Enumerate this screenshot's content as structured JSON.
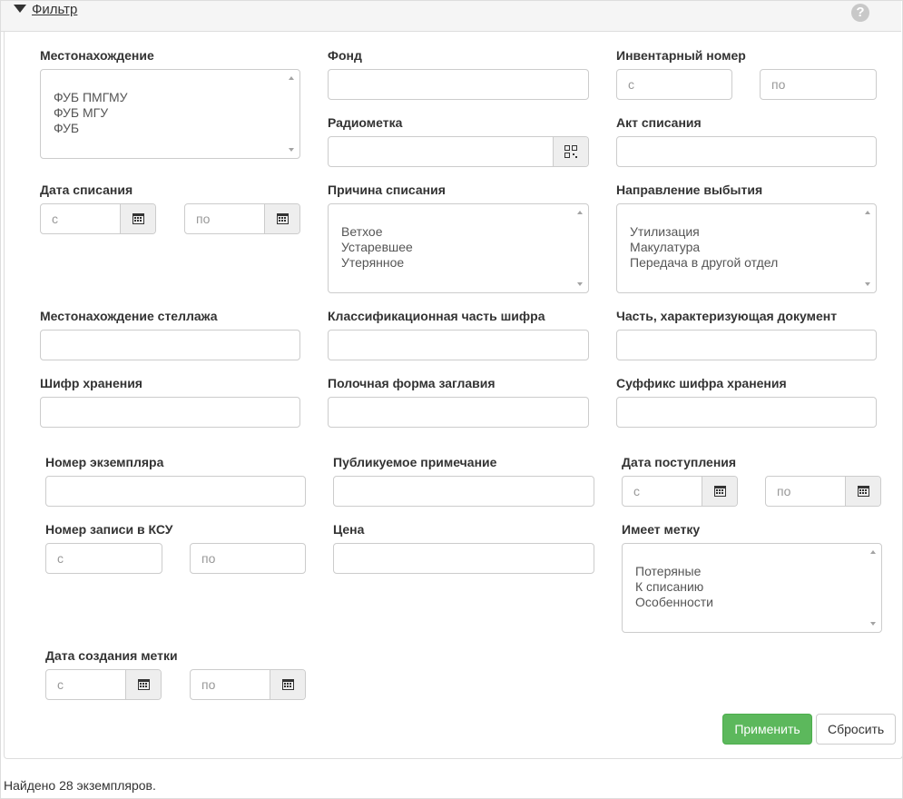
{
  "header": {
    "title": "Фильтр",
    "help_icon": "question-circle-icon"
  },
  "fields": {
    "location": {
      "label": "Местонахождение",
      "options": [
        "ФУБ ПМГМУ",
        "ФУБ МГУ",
        "ФУБ"
      ]
    },
    "fund": {
      "label": "Фонд",
      "value": ""
    },
    "inventory_number": {
      "label": "Инвентарный номер",
      "from_placeholder": "с",
      "to_placeholder": "по"
    },
    "radiomark": {
      "label": "Радиометка",
      "value": "",
      "icon": "qr-code-icon"
    },
    "writeoff_act": {
      "label": "Акт списания",
      "value": ""
    },
    "writeoff_date": {
      "label": "Дата списания",
      "from_placeholder": "с",
      "to_placeholder": "по"
    },
    "writeoff_reason": {
      "label": "Причина списания",
      "options": [
        "Ветхое",
        "Устаревшее",
        "Утерянное"
      ]
    },
    "disposal_direction": {
      "label": "Направление выбытия",
      "options": [
        "Утилизация",
        "Макулатура",
        "Передача в другой отдел"
      ]
    },
    "rack_location": {
      "label": "Местонахождение стеллажа",
      "value": ""
    },
    "classification_part": {
      "label": "Классификационная часть шифра",
      "value": ""
    },
    "document_part": {
      "label": "Часть, характеризующая документ",
      "value": ""
    },
    "storage_code": {
      "label": "Шифр хранения",
      "value": ""
    },
    "shelf_title": {
      "label": "Полочная форма заглавия",
      "value": ""
    },
    "storage_code_suffix": {
      "label": "Суффикс шифра хранения",
      "value": ""
    },
    "copy_number": {
      "label": "Номер экземпляра",
      "value": ""
    },
    "public_note": {
      "label": "Публикуемое примечание",
      "value": ""
    },
    "receipt_date": {
      "label": "Дата поступления",
      "from_placeholder": "с",
      "to_placeholder": "по"
    },
    "ksu_record": {
      "label": "Номер записи в КСУ",
      "from_placeholder": "с",
      "to_placeholder": "по"
    },
    "price": {
      "label": "Цена",
      "value": ""
    },
    "has_mark": {
      "label": "Имеет метку",
      "options": [
        "Потеряные",
        "К списанию",
        "Особенности"
      ]
    },
    "mark_created_date": {
      "label": "Дата создания метки",
      "from_placeholder": "с",
      "to_placeholder": "по"
    }
  },
  "buttons": {
    "apply": "Применить",
    "reset": "Сбросить"
  },
  "footer": {
    "found_text": "Найдено 28 экземпляров."
  },
  "colors": {
    "apply_bg": "#5cb85c",
    "header_bg": "#f5f5f5",
    "border": "#cccccc"
  }
}
